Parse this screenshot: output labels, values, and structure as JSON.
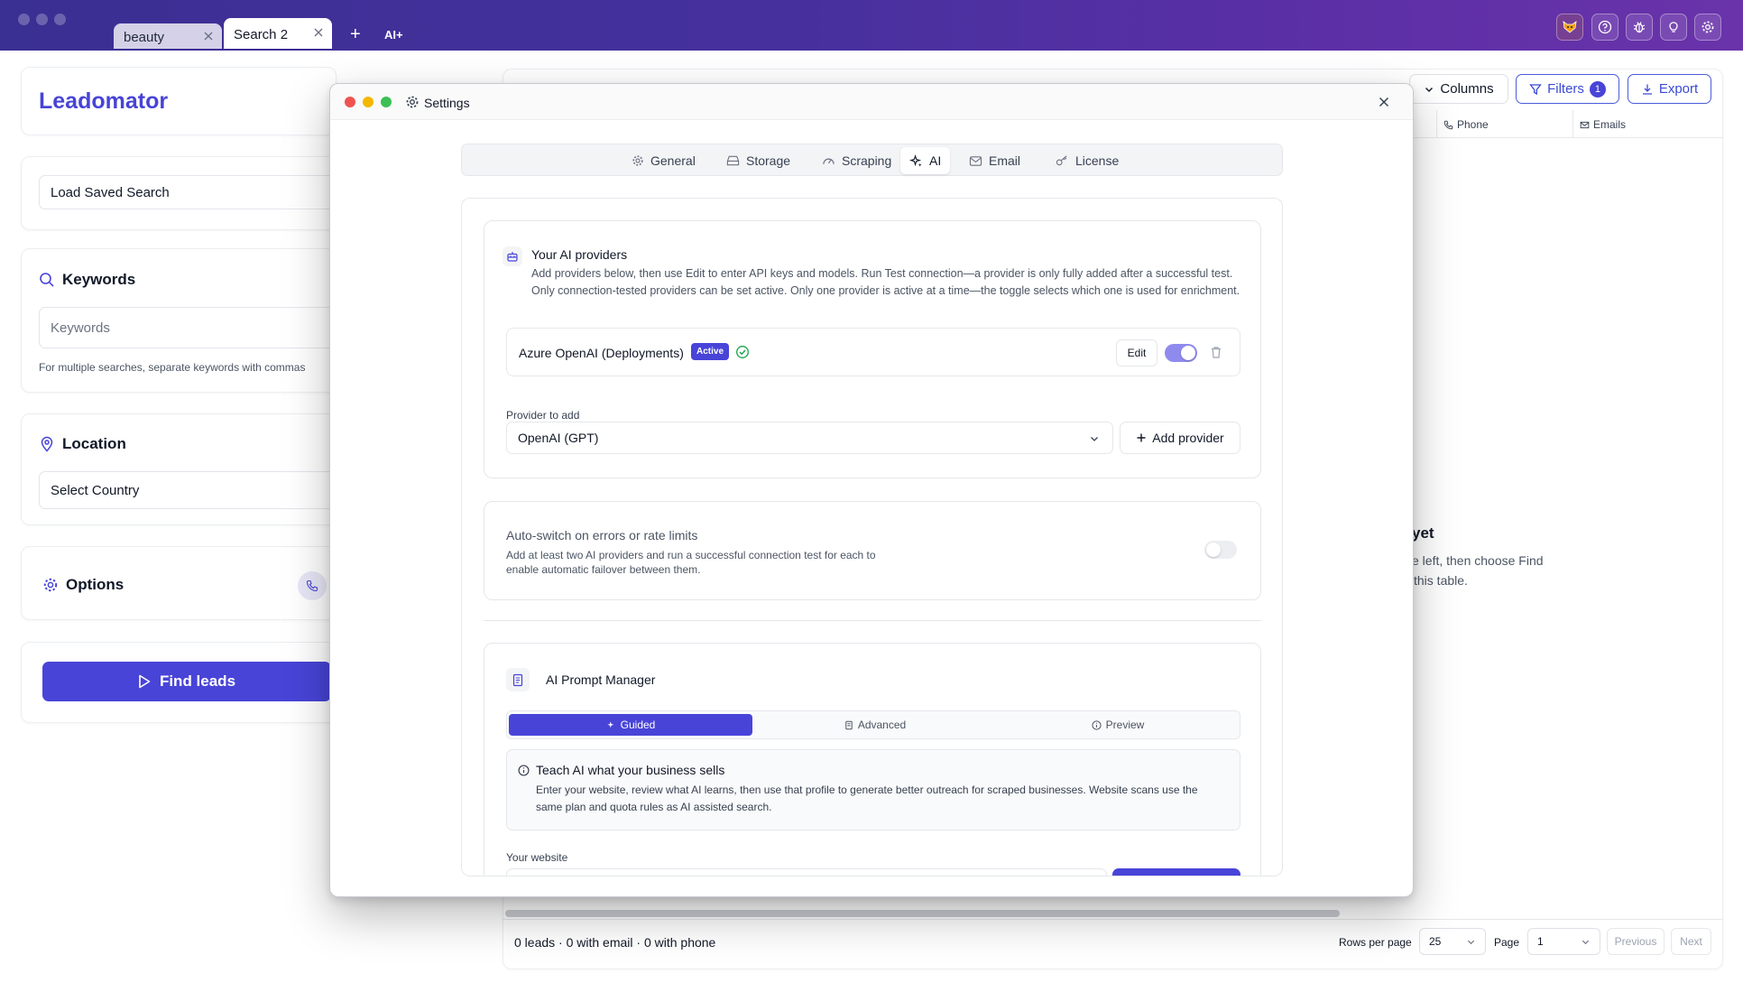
{
  "window": {
    "tabs": [
      {
        "label": "beauty",
        "active": false
      },
      {
        "label": "Search 2",
        "active": true
      }
    ],
    "new_tab_label": "+",
    "ai_label": "AI+",
    "toolbar_icons": [
      "fox-icon",
      "help-icon",
      "bug-icon",
      "lightbulb-icon",
      "gear-icon"
    ]
  },
  "sidebar": {
    "app_name": "Leadomator",
    "saved_search_placeholder": "Load Saved Search",
    "keywords": {
      "title": "Keywords",
      "placeholder": "Keywords",
      "helper": "For multiple searches, separate keywords with commas"
    },
    "location": {
      "title": "Location",
      "country_placeholder": "Select Country"
    },
    "options": {
      "title": "Options"
    },
    "find_button": "Find leads"
  },
  "main": {
    "toolbar": {
      "columns_label": "Columns",
      "filters_label": "Filters",
      "filters_count": "1",
      "export_label": "Export"
    },
    "columns": [
      "Phone",
      "Emails"
    ],
    "empty_state": {
      "title_fragment": "yet",
      "line1_fragment": "e left, then choose Find",
      "line2_fragment": "this table."
    },
    "footer": {
      "summary": "0 leads · 0 with email · 0 with phone",
      "rows_per_page_label": "Rows per page",
      "rows_per_page_value": "25",
      "page_label": "Page",
      "page_value": "1",
      "previous_label": "Previous",
      "next_label": "Next"
    }
  },
  "settings": {
    "title": "Settings",
    "tabs": [
      {
        "label": "General",
        "icon": "gear-icon"
      },
      {
        "label": "Storage",
        "icon": "hard-drive-icon"
      },
      {
        "label": "Scraping",
        "icon": "gauge-icon"
      },
      {
        "label": "AI",
        "icon": "sparkles-icon",
        "selected": true
      },
      {
        "label": "Email",
        "icon": "mail-icon"
      },
      {
        "label": "License",
        "icon": "key-icon"
      }
    ],
    "providers": {
      "title": "Your AI providers",
      "description": "Add providers below, then use Edit to enter API keys and models. Run Test connection—a provider is only fully added after a successful test. Only connection-tested providers can be set active. Only one provider is active at a time—the toggle selects which one is used for enrichment.",
      "items": [
        {
          "name": "Azure OpenAI (Deployments)",
          "badge": "Active",
          "edit_label": "Edit",
          "enabled": true
        }
      ],
      "provider_to_add_label": "Provider to add",
      "provider_to_add_value": "OpenAI (GPT)",
      "add_button": "Add provider"
    },
    "auto_switch": {
      "title": "Auto-switch on errors or rate limits",
      "description": "Add at least two AI providers and run a successful connection test for each to enable automatic failover between them.",
      "enabled": false
    },
    "prompt_manager": {
      "title": "AI Prompt Manager",
      "modes": [
        {
          "label": "Guided",
          "selected": true
        },
        {
          "label": "Advanced",
          "selected": false
        },
        {
          "label": "Preview",
          "selected": false
        }
      ],
      "info_title": "Teach AI what your business sells",
      "info_text": "Enter your website, review what AI learns, then use that profile to generate better outreach for scraped businesses. Website scans use the same plan and quota rules as AI assisted search.",
      "website_label": "Your website"
    }
  },
  "colors": {
    "accent": "#4844d8",
    "titlebar_start": "#3a2f92",
    "titlebar_end": "#6a33aa",
    "success": "#16a34a"
  }
}
